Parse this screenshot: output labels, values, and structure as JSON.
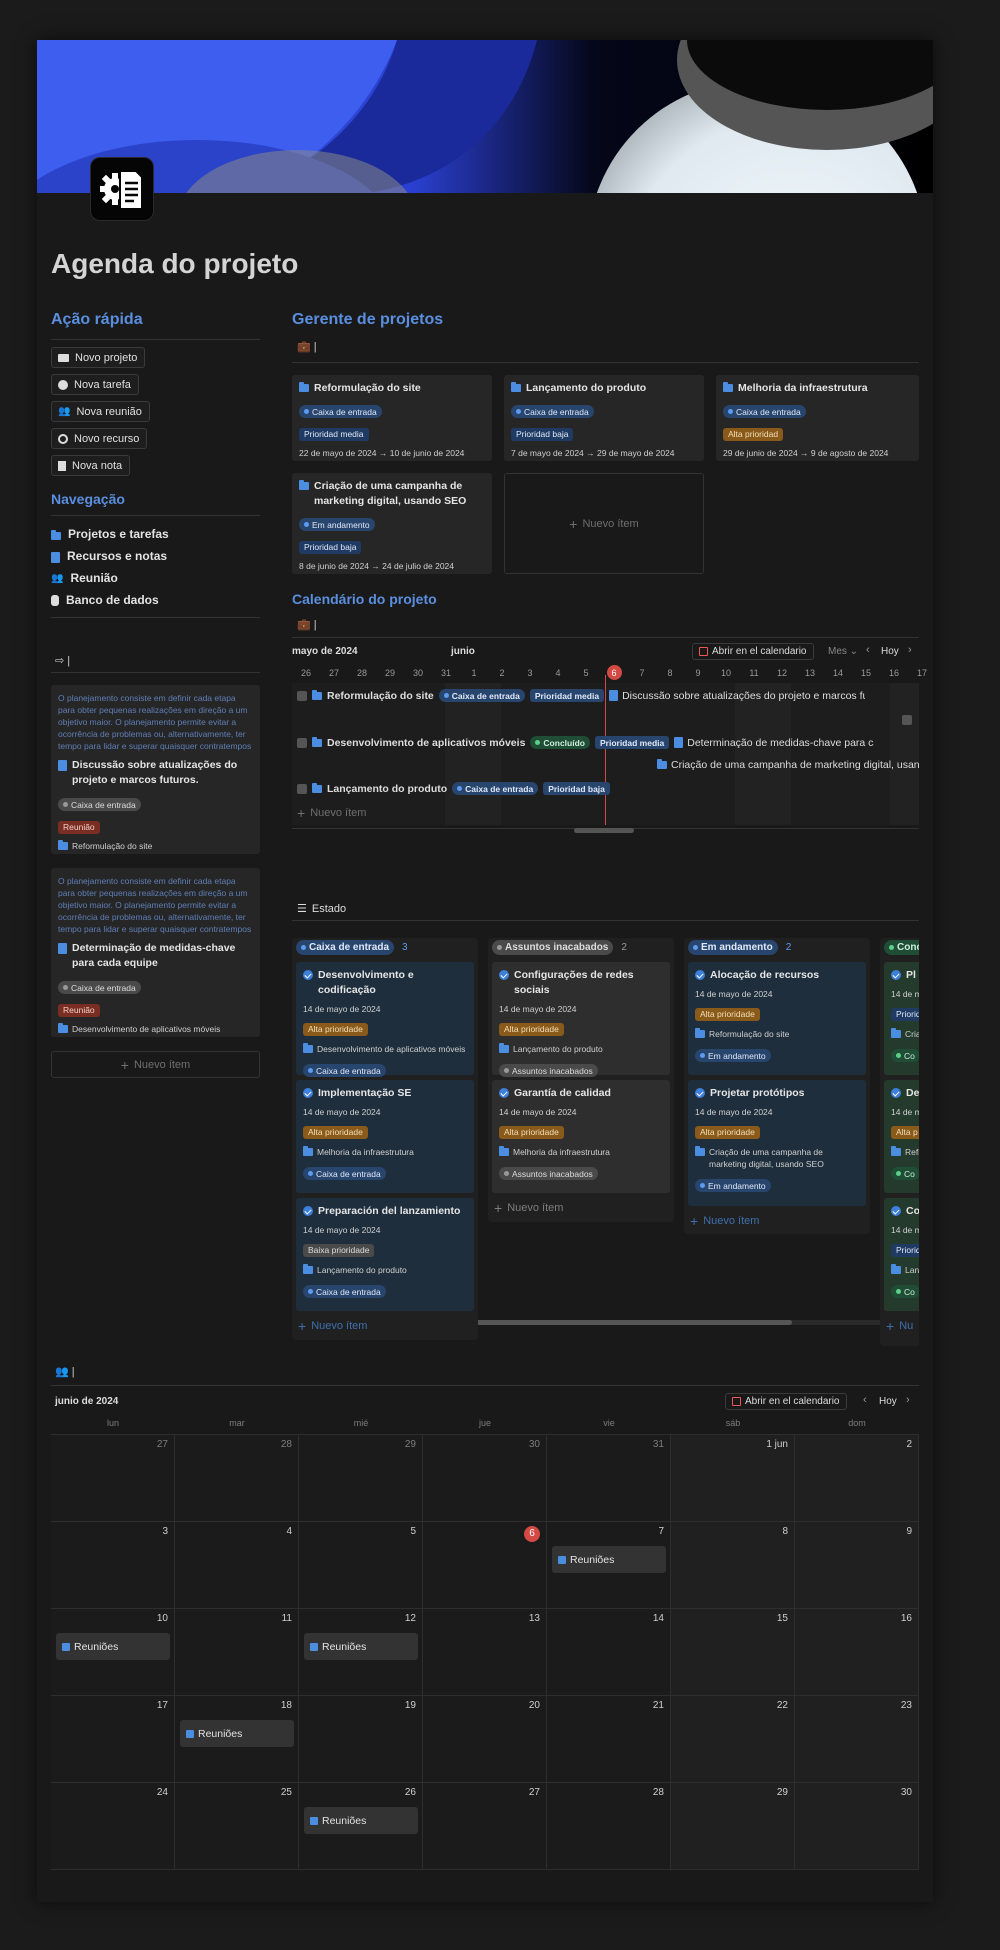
{
  "page": {
    "title": "Agenda do projeto"
  },
  "quick": {
    "heading": "Ação rápida",
    "buttons": [
      "Novo projeto",
      "Nova tarefa",
      "Nova reunião",
      "Novo recurso",
      "Nova nota"
    ]
  },
  "nav": {
    "heading": "Navegação",
    "items": [
      "Projetos e tarefas",
      "Recursos e notas",
      "Reunião",
      "Banco de dados"
    ]
  },
  "notes": {
    "cursor_label": "|",
    "cards": [
      {
        "text": "O planejamento consiste em definir cada etapa para obter pequenas realizações em direção a um objetivo maior. O planejamento permite evitar a ocorrência de problemas ou, alternativamente, ter tempo para lidar e superar quaisquer contratempos",
        "title": "Discussão sobre atualizações do projeto e marcos futuros.",
        "status": "Caixa de entrada",
        "type": "Reunião",
        "project": "Reformulação do site"
      },
      {
        "text": "O planejamento consiste em definir cada etapa para obter pequenas realizações em direção a um objetivo maior. O planejamento permite evitar a ocorrência de problemas ou, alternativamente, ter tempo para lidar e superar quaisquer contratempos",
        "title": "Determinação de medidas-chave para cada equipe",
        "status": "Caixa de entrada",
        "type": "Reunião",
        "project": "Desenvolvimento de aplicativos móveis"
      }
    ],
    "new_item": "Nuevo ítem"
  },
  "pm": {
    "heading": "Gerente de projetos",
    "view_label": "|",
    "cards": [
      {
        "title": "Reformulação do site",
        "status": "Caixa de entrada",
        "priority": "Prioridad media",
        "dates": "22 de mayo de 2024 → 10 de junio de 2024"
      },
      {
        "title": "Lançamento do produto",
        "status": "Caixa de entrada",
        "priority": "Prioridad baja",
        "dates": "7 de mayo de 2024 → 29 de mayo de 2024"
      },
      {
        "title": "Melhoria da infraestrutura",
        "status": "Caixa de entrada",
        "priority": "Alta prioridad",
        "dates": "29 de junio de 2024 → 9 de agosto de 2024"
      },
      {
        "title": "Criação de uma campanha de marketing digital, usando SEO",
        "status": "Em andamento",
        "priority": "Prioridad baja",
        "dates": "8 de junio de 2024 → 24 de julio de 2024"
      }
    ],
    "new_item": "Nuevo ítem"
  },
  "timeline": {
    "heading": "Calendário do projeto",
    "view_label": "|",
    "month_left": "mayo de 2024",
    "month_right": "junio",
    "open_cal": "Abrir en el calendario",
    "mode": "Mes",
    "today": "Hoy",
    "days": [
      "26",
      "27",
      "28",
      "29",
      "30",
      "31",
      "1",
      "2",
      "3",
      "4",
      "5",
      "6",
      "7",
      "8",
      "9",
      "10",
      "11",
      "12",
      "13",
      "14",
      "15",
      "16",
      "17"
    ],
    "rows": [
      {
        "name": "Reformulação do site",
        "status": "Caixa de entrada",
        "priority": "Prioridad media",
        "sub": "Discussão sobre atualizações do projeto e marcos futuros."
      },
      {
        "name": "Desenvolvimento de aplicativos móveis",
        "status": "Concluído",
        "priority": "Prioridad media",
        "sub": "Determinação de medidas-chave para cada equipe",
        "sub2": "Criação de uma campanha de marketing digital, usando SEO"
      },
      {
        "name": "Lançamento do produto",
        "status": "Caixa de entrada",
        "priority": "Prioridad baja"
      }
    ],
    "new_item": "Nuevo ítem"
  },
  "board": {
    "heading": "Estado",
    "columns": [
      {
        "name": "Caixa de entrada",
        "count": "3",
        "cards": [
          {
            "title": "Desenvolvimento e codificação",
            "date": "14 de mayo de 2024",
            "priority": "Alta prioridade",
            "project": "Desenvolvimento de aplicativos móveis",
            "status": "Caixa de entrada"
          },
          {
            "title": "Implementação SE",
            "date": "14 de mayo de 2024",
            "priority": "Alta prioridade",
            "project": "Melhoria da infraestrutura",
            "status": "Caixa de entrada"
          },
          {
            "title": "Preparación del lanzamiento",
            "date": "14 de mayo de 2024",
            "priority": "Baixa prioridade",
            "project": "Lançamento do produto",
            "status": "Caixa de entrada"
          }
        ]
      },
      {
        "name": "Assuntos inacabados",
        "count": "2",
        "cards": [
          {
            "title": "Configurações de redes sociais",
            "date": "14 de mayo de 2024",
            "priority": "Alta prioridade",
            "project": "Lançamento do produto",
            "status": "Assuntos inacabados"
          },
          {
            "title": "Garantía de calidad",
            "date": "14 de mayo de 2024",
            "priority": "Alta prioridade",
            "project": "Melhoria da infraestrutura",
            "status": "Assuntos inacabados"
          }
        ]
      },
      {
        "name": "Em andamento",
        "count": "2",
        "cards": [
          {
            "title": "Alocação de recursos",
            "date": "14 de mayo de 2024",
            "priority": "Alta prioridade",
            "project": "Reformulação do site",
            "status": "Em andamento"
          },
          {
            "title": "Projetar protótipos",
            "date": "14 de mayo de 2024",
            "priority": "Alta prioridade",
            "project": "Criação de uma campanha de marketing digital, usando SEO",
            "status": "Em andamento"
          }
        ]
      },
      {
        "name": "Conc",
        "count": "",
        "cards": [
          {
            "title": "Pl",
            "date": "14 de m",
            "priority": "Priorid",
            "project": "Cria market",
            "status": "Co"
          },
          {
            "title": "De",
            "date": "14 de m",
            "priority": "Alta p",
            "project": "Refi",
            "status": "Co"
          },
          {
            "title": "Co",
            "date": "14 de m",
            "priority": "Priorid",
            "project": "Lan",
            "status": "Co"
          }
        ]
      }
    ],
    "new_item": "Nuevo ítem",
    "new_short": "Nu"
  },
  "calendar": {
    "view_label": "|",
    "month": "junio de 2024",
    "open_cal": "Abrir en el calendario",
    "today": "Hoy",
    "weekdays": [
      "lun",
      "mar",
      "mié",
      "jue",
      "vie",
      "sáb",
      "dom"
    ],
    "weeks": [
      [
        "27",
        "28",
        "29",
        "30",
        "31",
        "1 jun",
        "2"
      ],
      [
        "3",
        "4",
        "5",
        "6",
        "7",
        "8",
        "9"
      ],
      [
        "10",
        "11",
        "12",
        "13",
        "14",
        "15",
        "16"
      ],
      [
        "17",
        "18",
        "19",
        "20",
        "21",
        "22",
        "23"
      ],
      [
        "24",
        "25",
        "26",
        "27",
        "28",
        "29",
        "30"
      ]
    ],
    "event": "Reuniões"
  }
}
